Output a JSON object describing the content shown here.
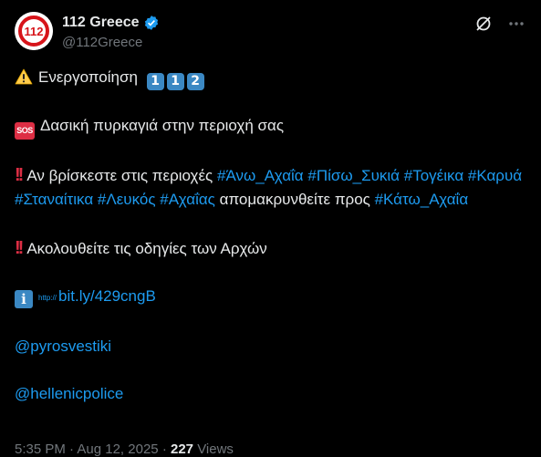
{
  "author": {
    "display_name": "112 Greece",
    "handle": "@112Greece",
    "avatar_text": "112"
  },
  "post": {
    "line1_text": "Ενεργοποίηση",
    "line1_digits": [
      "1",
      "1",
      "2"
    ],
    "line2_badge": "SOS",
    "line2_text": "Δασική πυρκαγιά στην περιοχή σας",
    "line3_prefix": "Αν βρίσκεστε στις περιοχές",
    "hashtags_area": [
      "#Άνω_Αχαΐα",
      "#Πίσω_Συκιά",
      "#Τογέικα",
      "#Καρυά",
      "#Σταναίτικα",
      "#Λευκός",
      "#Αχαΐας"
    ],
    "line3_mid": "απομακρυνθείτε",
    "line3_pros": "προς",
    "hashtag_dest": "#Κάτω_Αχαΐα",
    "line4_text": "Ακολουθείτε τις οδηγίες των Αρχών",
    "info_badge": "i",
    "url_prefix": "http://",
    "url": "bit.ly/429cngB",
    "mention1": "@pyrosvestiki",
    "mention2": "@hellenicpolice"
  },
  "meta": {
    "time": "5:35 PM",
    "separator": "·",
    "date": "Aug 12, 2025",
    "views_count": "227",
    "views_label": "Views"
  },
  "colors": {
    "background": "#000000",
    "text": "#e7e9ea",
    "link": "#1d9bf0",
    "muted": "#71767b",
    "alert_red": "#dd2e44",
    "keycap_blue": "#3b88c3"
  },
  "icons": [
    "verified-badge-icon",
    "grok-icon",
    "more-icon",
    "warning-icon",
    "sos-icon",
    "double-exclamation-icon",
    "information-icon"
  ]
}
